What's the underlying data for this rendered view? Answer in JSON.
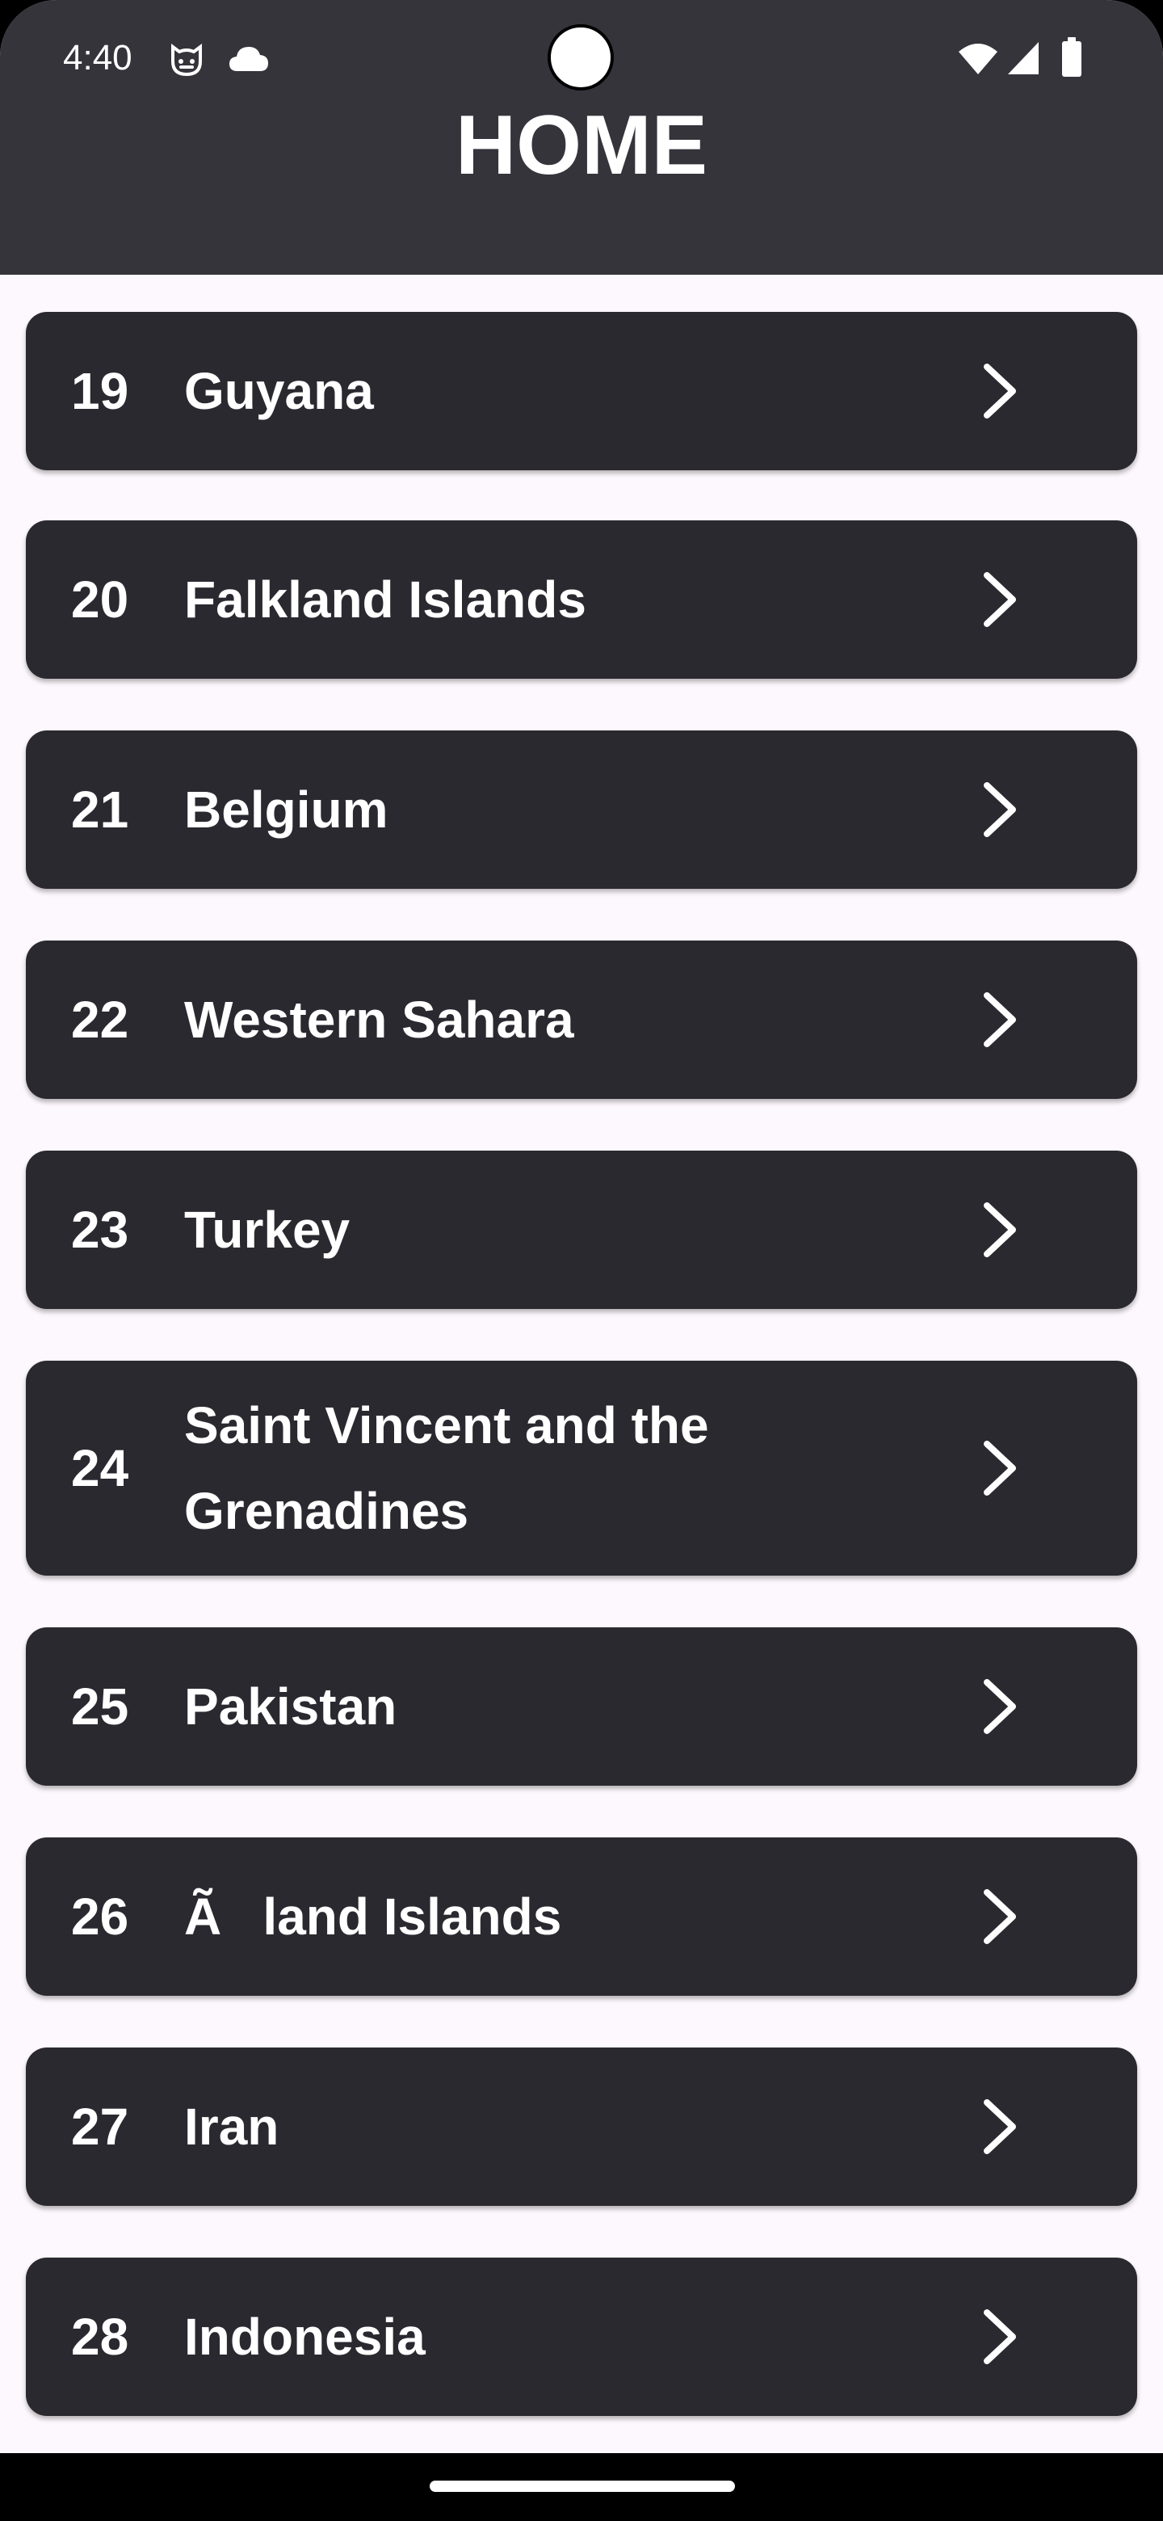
{
  "status_bar": {
    "time": "4:40",
    "left_icons": [
      "cat-face-icon",
      "cloud-icon"
    ],
    "right_icons": [
      "wifi-icon",
      "signal-icon",
      "battery-icon"
    ]
  },
  "app_bar": {
    "title": "HOME"
  },
  "colors": {
    "app_bar_bg": "#35343b",
    "card_bg": "#2b2930",
    "page_bg": "#fdf8fd",
    "text": "#ffffff"
  },
  "countries": [
    {
      "number": "19",
      "name": "Guyana"
    },
    {
      "number": "20",
      "name": "Falkland Islands"
    },
    {
      "number": "21",
      "name": "Belgium"
    },
    {
      "number": "22",
      "name": "Western Sahara"
    },
    {
      "number": "23",
      "name": "Turkey"
    },
    {
      "number": "24",
      "name": "Saint Vincent and the Grenadines"
    },
    {
      "number": "25",
      "name": "Pakistan"
    },
    {
      "number": "26",
      "name": "Ãland Islands"
    },
    {
      "number": "27",
      "name": "Iran"
    },
    {
      "number": "28",
      "name": "Indonesia"
    }
  ]
}
